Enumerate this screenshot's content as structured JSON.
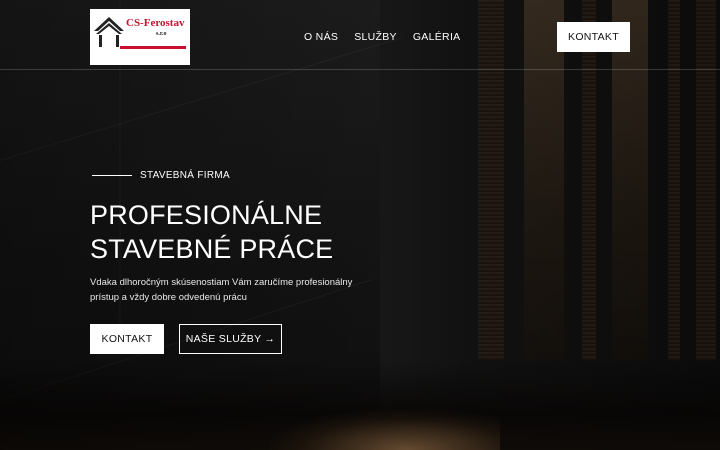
{
  "logo": {
    "name": "CS-Ferostav",
    "suffix": "s.r.o"
  },
  "nav": {
    "items": [
      {
        "label": "O NÁS"
      },
      {
        "label": "SLUŽBY"
      },
      {
        "label": "GALÉRIA"
      }
    ],
    "contact_button": "KONTAKT"
  },
  "hero": {
    "eyebrow": "STAVEBNÁ FIRMA",
    "headline_line1": "PROFESIONÁLNE",
    "headline_line2": "STAVEBNÉ PRÁCE",
    "description": "Vdaka dlhoročným skúsenostiam Vám zaručíme profesionálny prístup a vždy dobre odvedenú prácu",
    "primary_button": "KONTAKT",
    "secondary_button": "NAŠE SLUŽBY",
    "secondary_button_icon": "arrow-right-icon"
  },
  "colors": {
    "brand_red": "#c8102e",
    "background": "#111111",
    "button_bg": "#ffffff"
  }
}
